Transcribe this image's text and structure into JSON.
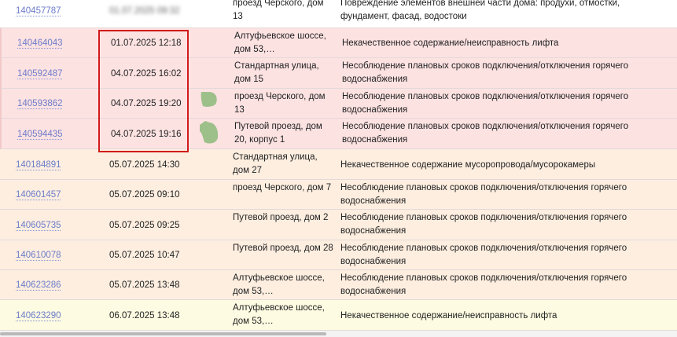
{
  "rows": [
    {
      "id": "140457787",
      "date": "01.07.2025 09:32",
      "date_blurred": true,
      "address": "проезд Черского, дом 13",
      "description": "Повреждение элементов внешней части дома: продухи, отмостки, фундамент, фасад, водостоки",
      "tint": "white"
    },
    {
      "id": "140464043",
      "date": "01.07.2025 12:18",
      "address": "Алтуфьевское шоссе, дом 53,…",
      "description": "Некачественное содержание/неисправность лифта",
      "tint": "pink"
    },
    {
      "id": "140592487",
      "date": "04.07.2025 16:02",
      "address": "Стандартная улица, дом 15",
      "description": "Несоблюдение плановых сроков подключения/отключения горячего водоснабжения",
      "tint": "pink"
    },
    {
      "id": "140593862",
      "date": "04.07.2025 19:20",
      "address": "проезд Черского, дом 13",
      "description": "Несоблюдение плановых сроков подключения/отключения горячего водоснабжения",
      "tint": "pink"
    },
    {
      "id": "140594435",
      "date": "04.07.2025 19:16",
      "address": "Путевой проезд, дом 20, корпус 1",
      "description": "Несоблюдение плановых сроков подключения/отключения горячего водоснабжения",
      "tint": "pink"
    },
    {
      "id": "140184891",
      "date": "05.07.2025 14:30",
      "address": "Стандартная улица, дом 27",
      "description": "Некачественное содержание мусоропровода/мусорокамеры",
      "tint": "peach"
    },
    {
      "id": "140601457",
      "date": "05.07.2025 09:10",
      "address": "проезд Черского, дом 7",
      "description": "Несоблюдение плановых сроков подключения/отключения горячего водоснабжения",
      "tint": "peach"
    },
    {
      "id": "140605735",
      "date": "05.07.2025 09:25",
      "address": "Путевой проезд, дом 2",
      "description": "Несоблюдение плановых сроков подключения/отключения горячего водоснабжения",
      "tint": "peach"
    },
    {
      "id": "140610078",
      "date": "05.07.2025 10:47",
      "address": "Путевой проезд, дом 28",
      "description": "Несоблюдение плановых сроков подключения/отключения горячего водоснабжения",
      "tint": "peach"
    },
    {
      "id": "140623286",
      "date": "05.07.2025 13:48",
      "address": "Алтуфьевское шоссе, дом 53,…",
      "description": "Несоблюдение плановых сроков подключения/отключения горячего водоснабжения",
      "tint": "peach"
    },
    {
      "id": "140623290",
      "date": "06.07.2025 13:48",
      "address": "Алтуфьевское шоссе, дом 53,…",
      "description": "Некачественное содержание/неисправность лифта",
      "tint": "yellow"
    }
  ],
  "colors": {
    "highlight_box": "#d11a1a",
    "link": "#6c7cc9",
    "pink_row": "#fde2e2",
    "peach_row": "#fdeee0",
    "yellow_row": "#fdfbe1",
    "status_blob": "#9dc08b"
  }
}
